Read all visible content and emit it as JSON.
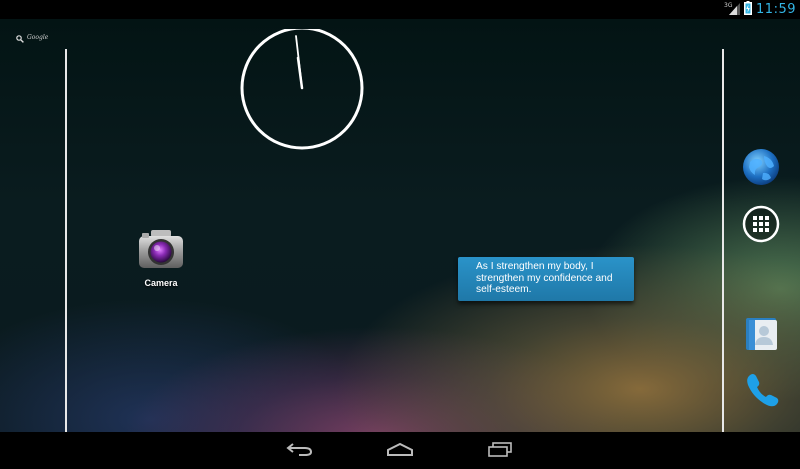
{
  "status_bar": {
    "time": "11:59",
    "network_type": "3G",
    "icons": [
      "signal-3g-icon",
      "battery-charging-icon"
    ],
    "accent_color": "#33b5e5"
  },
  "search": {
    "label": "Google",
    "icon": "search-icon"
  },
  "clock_widget": {
    "hour": 11,
    "minute": 59
  },
  "apps": {
    "camera": {
      "label": "Camera",
      "icon": "camera-icon"
    }
  },
  "quote_widget": {
    "text": "As I strengthen my body, I strengthen my confidence and self-esteem.",
    "color": "#2a93c9"
  },
  "hotseat": {
    "items": [
      {
        "icon": "browser-globe-icon"
      },
      {
        "icon": "all-apps-icon"
      },
      {
        "icon": "people-contacts-icon"
      },
      {
        "icon": "phone-icon"
      }
    ]
  },
  "nav_bar": {
    "buttons": [
      "back-icon",
      "home-icon",
      "recents-icon"
    ]
  }
}
